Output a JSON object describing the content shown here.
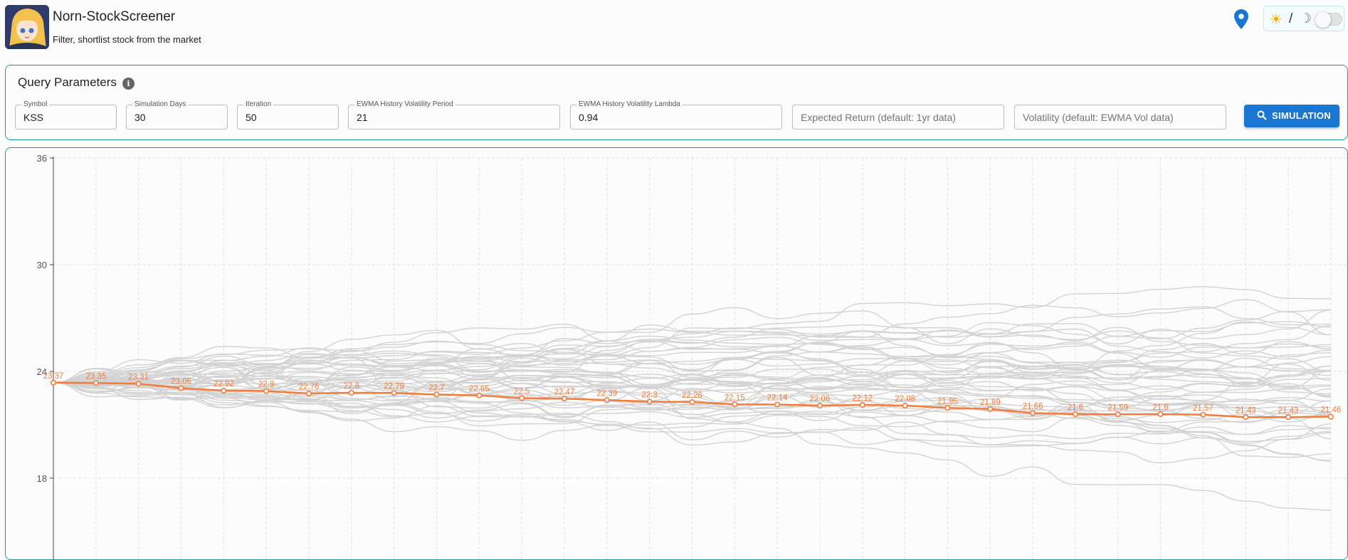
{
  "header": {
    "title": "Norn-StockScreener",
    "subtitle": "Filter, shortlist stock from the market",
    "theme_slash": "/"
  },
  "params": {
    "title": "Query Parameters",
    "fields": [
      {
        "label": "Symbol",
        "value": "KSS"
      },
      {
        "label": "Simulation Days",
        "value": "30"
      },
      {
        "label": "Iteration",
        "value": "50"
      },
      {
        "label": "EWMA History Volatility Period",
        "value": "21"
      },
      {
        "label": "EWMA History Volatility Lambda",
        "value": "0.94"
      }
    ],
    "expected_return_placeholder": "Expected Return (default: 1yr data)",
    "volatility_placeholder": "Volatility (default: EWMA Vol data)",
    "simulate_label": "SIMULATION"
  },
  "colors": {
    "accent": "#1a9c95",
    "button": "#1976d2",
    "mean_line": "#f47b3a",
    "paths": "#d3d3d3"
  },
  "chart_data": {
    "type": "line",
    "grid": true,
    "x": [
      0,
      1,
      2,
      3,
      4,
      5,
      6,
      7,
      8,
      9,
      10,
      11,
      12,
      13,
      14,
      15,
      16,
      17,
      18,
      19,
      20,
      21,
      22,
      23,
      24,
      25,
      26,
      27,
      28,
      29,
      30
    ],
    "ylim": [
      18,
      36
    ],
    "yticks": [
      18,
      24,
      30,
      36
    ],
    "series": [
      {
        "values": [
          23.37,
          23.35,
          23.31,
          23.06,
          22.92,
          22.9,
          22.76,
          22.8,
          22.79,
          22.7,
          22.65,
          22.5,
          22.47,
          22.39,
          22.3,
          22.28,
          22.15,
          22.14,
          22.08,
          22.12,
          22.08,
          21.95,
          21.89,
          21.66,
          21.6,
          21.59,
          21.6,
          21.57,
          21.43,
          21.43,
          21.46
        ],
        "labels": [
          "23.37",
          "23.35",
          "23.31",
          "23.06",
          "22.92",
          "22.9",
          "22.76",
          "22.8",
          "22.79",
          "22.7",
          "22.65",
          "22.5",
          "22.47",
          "22.39",
          "22.3",
          "22.28",
          "22.15",
          "22.14",
          "22.08",
          "22.12",
          "22.08",
          "21.95",
          "21.89",
          "21.66",
          "21.6",
          "21.59",
          "21.6",
          "21.57",
          "21.43",
          "21.43",
          "21.46"
        ]
      }
    ],
    "simulated_paths": 50
  }
}
